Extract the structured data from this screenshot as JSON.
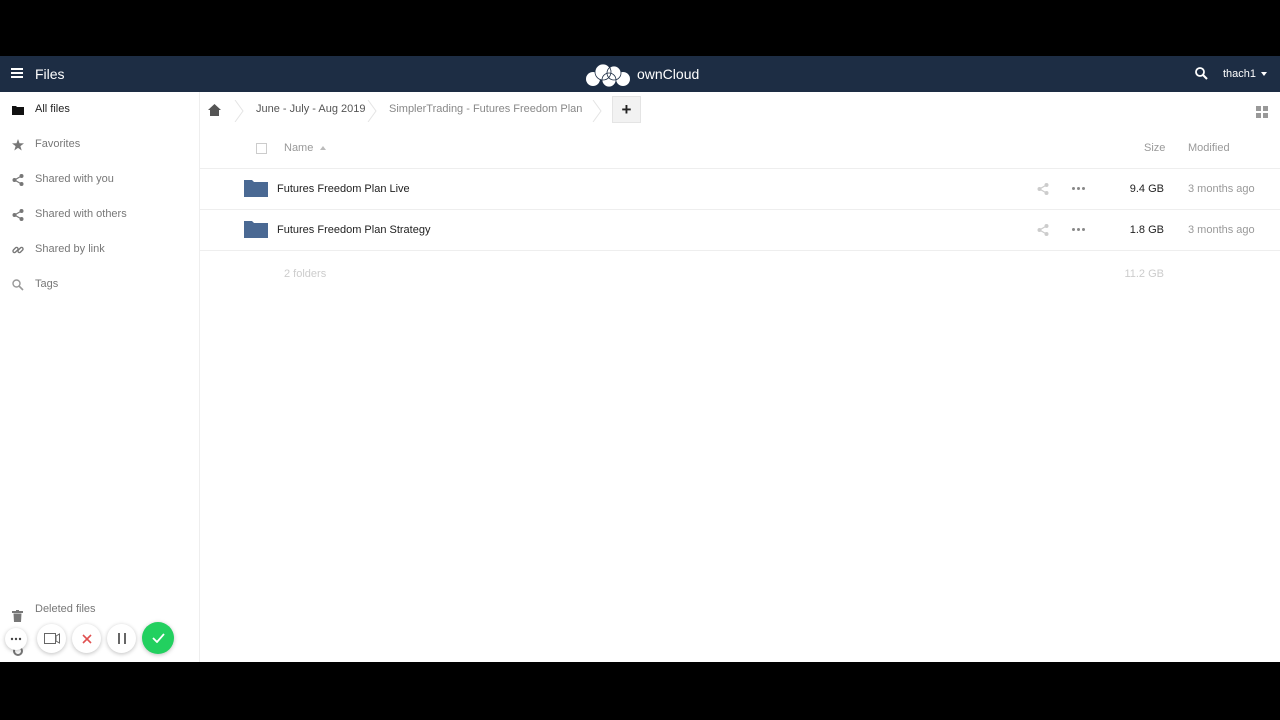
{
  "header": {
    "title": "Files",
    "brand": "ownCloud",
    "user": "thach1"
  },
  "sidebar": {
    "items": [
      {
        "label": "All files",
        "icon": "folder-icon"
      },
      {
        "label": "Favorites",
        "icon": "star-icon"
      },
      {
        "label": "Shared with you",
        "icon": "share-icon"
      },
      {
        "label": "Shared with others",
        "icon": "share-icon"
      },
      {
        "label": "Shared by link",
        "icon": "link-icon"
      },
      {
        "label": "Tags",
        "icon": "search-icon"
      }
    ],
    "deleted_files": "Deleted files"
  },
  "breadcrumb": {
    "items": [
      "June - July - Aug 2019",
      "SimplerTrading - Futures Freedom Plan"
    ]
  },
  "table": {
    "columns": {
      "name": "Name",
      "size": "Size",
      "modified": "Modified"
    },
    "rows": [
      {
        "name": "Futures Freedom Plan Live",
        "size": "9.4 GB",
        "modified": "3 months ago"
      },
      {
        "name": "Futures Freedom Plan Strategy",
        "size": "1.8 GB",
        "modified": "3 months ago"
      }
    ],
    "summary": {
      "count": "2 folders",
      "size": "11.2 GB"
    }
  },
  "colors": {
    "header_bg": "#1d2d44",
    "folder": "#4a6993",
    "confirm_green": "#22d05f"
  }
}
